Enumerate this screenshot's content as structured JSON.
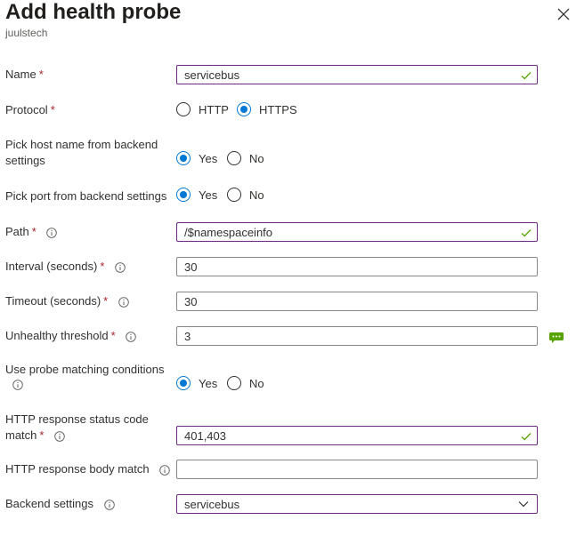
{
  "header": {
    "title": "Add health probe",
    "subtitle": "juulstech"
  },
  "fields": {
    "name": {
      "label": "Name",
      "required": "*",
      "value": "servicebus"
    },
    "protocol": {
      "label": "Protocol",
      "required": "*",
      "options": [
        "HTTP",
        "HTTPS"
      ],
      "selected": "HTTPS"
    },
    "pick_host": {
      "label_line1": "Pick host name from backend",
      "label_line2": "settings",
      "options": [
        "Yes",
        "No"
      ],
      "selected": "Yes"
    },
    "pick_port": {
      "label": "Pick port from backend settings",
      "options": [
        "Yes",
        "No"
      ],
      "selected": "Yes"
    },
    "path": {
      "label": "Path",
      "required": "*",
      "value": "/$namespaceinfo"
    },
    "interval": {
      "label": "Interval (seconds)",
      "required": "*",
      "value": "30"
    },
    "timeout": {
      "label": "Timeout (seconds)",
      "required": "*",
      "value": "30"
    },
    "unhealthy": {
      "label": "Unhealthy threshold",
      "required": "*",
      "value": "3"
    },
    "probe_matching": {
      "label": "Use probe matching conditions",
      "options": [
        "Yes",
        "No"
      ],
      "selected": "Yes"
    },
    "status_code": {
      "label_line1": "HTTP response status code",
      "label_line2": "match",
      "required": "*",
      "value": "401,403"
    },
    "body_match": {
      "label": "HTTP response body match",
      "value": ""
    },
    "backend_settings": {
      "label": "Backend settings",
      "value": "servicebus"
    }
  },
  "colors": {
    "accent": "#0078d4",
    "valid_border": "#6b2a80",
    "check": "#57a300",
    "required": "#a4262c"
  },
  "icons": [
    "close-icon",
    "info-icon",
    "checkmark-icon",
    "chevron-down-icon",
    "comment-icon"
  ]
}
